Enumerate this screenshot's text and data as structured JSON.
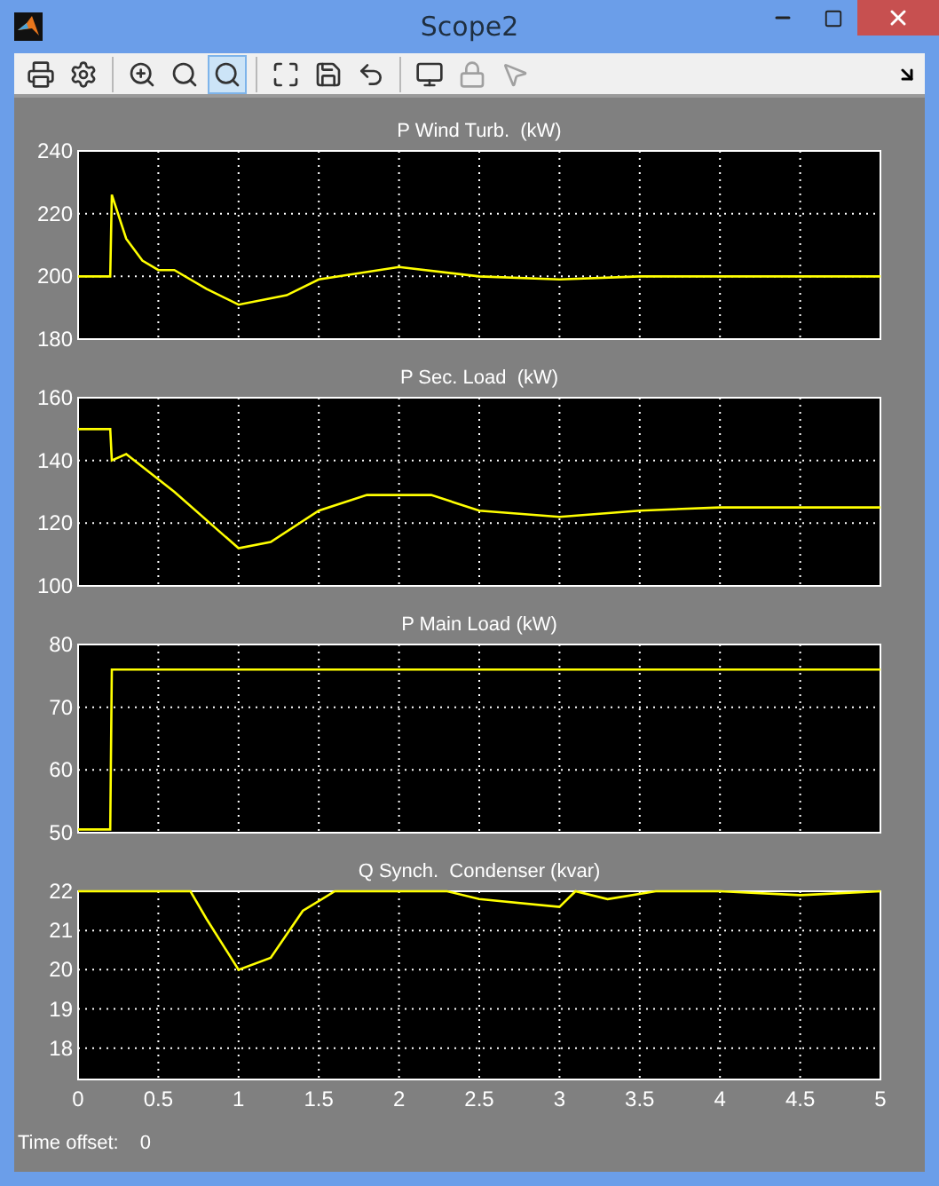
{
  "window": {
    "title": "Scope2"
  },
  "toolbar": {
    "groups": [
      [
        {
          "kind": "print",
          "selected": false,
          "disabled": false
        },
        {
          "kind": "parameters",
          "selected": false,
          "disabled": false
        }
      ],
      [
        {
          "kind": "zoom",
          "selected": false,
          "disabled": false
        },
        {
          "kind": "zoom_x",
          "selected": false,
          "disabled": false
        },
        {
          "kind": "zoom_y",
          "selected": true,
          "disabled": false
        }
      ],
      [
        {
          "kind": "autoscale",
          "selected": false,
          "disabled": false
        },
        {
          "kind": "save_axes",
          "selected": false,
          "disabled": false
        },
        {
          "kind": "restore_axes",
          "selected": false,
          "disabled": false
        }
      ],
      [
        {
          "kind": "floating",
          "selected": false,
          "disabled": false
        },
        {
          "kind": "lock",
          "selected": false,
          "disabled": true
        },
        {
          "kind": "signal_select",
          "selected": false,
          "disabled": true
        }
      ]
    ]
  },
  "scopes": [
    {
      "chart_data": {
        "type": "line",
        "title": "P Wind Turb.  (kW)",
        "x": [
          0,
          0.2,
          0.21,
          0.3,
          0.4,
          0.5,
          0.6,
          0.8,
          1.0,
          1.3,
          1.5,
          2.0,
          2.5,
          3.0,
          3.5,
          4.0,
          4.5,
          5.0
        ],
        "series": [
          {
            "color": "#ffff00",
            "values": [
              200,
              200,
              226,
              212,
              205,
              202,
              202,
              196,
              191,
              194,
              199,
              203,
              200,
              199,
              200,
              200,
              200,
              200
            ]
          }
        ],
        "xlim": [
          0,
          5
        ],
        "ylim": [
          180,
          240
        ],
        "yticks": [
          180,
          200,
          220,
          240
        ],
        "grid": true
      }
    },
    {
      "chart_data": {
        "type": "line",
        "title": "P Sec. Load  (kW)",
        "x": [
          0,
          0.2,
          0.21,
          0.3,
          0.6,
          1.0,
          1.2,
          1.5,
          1.8,
          2.2,
          2.5,
          3.0,
          3.5,
          4.0,
          4.5,
          5.0
        ],
        "series": [
          {
            "color": "#ffff00",
            "values": [
              150,
              150,
              140,
              142,
              130,
              112,
              114,
              124,
              129,
              129,
              124,
              122,
              124,
              125,
              125,
              125
            ]
          }
        ],
        "xlim": [
          0,
          5
        ],
        "ylim": [
          100,
          160
        ],
        "yticks": [
          100,
          120,
          140,
          160
        ],
        "grid": true
      }
    },
    {
      "chart_data": {
        "type": "line",
        "title": "P Main Load (kW)",
        "x": [
          0,
          0.2,
          0.21,
          0.3,
          5.0
        ],
        "series": [
          {
            "color": "#ffff00",
            "values": [
              50.5,
              50.5,
              76,
              76,
              76
            ]
          }
        ],
        "xlim": [
          0,
          5
        ],
        "ylim": [
          50,
          80
        ],
        "yticks": [
          50,
          60,
          70,
          80
        ],
        "grid": true
      }
    },
    {
      "chart_data": {
        "type": "line",
        "title": "Q Synch.  Condenser (kvar)",
        "x": [
          0,
          0.7,
          0.8,
          1.0,
          1.2,
          1.4,
          1.6,
          2.3,
          2.5,
          3.0,
          3.1,
          3.3,
          3.6,
          4.0,
          4.5,
          5.0
        ],
        "series": [
          {
            "color": "#ffff00",
            "values": [
              22,
              22,
              21.3,
              20,
              20.3,
              21.5,
              22,
              22,
              21.8,
              21.6,
              22,
              21.8,
              22,
              22,
              21.9,
              22
            ]
          }
        ],
        "xlim": [
          0,
          5
        ],
        "ylim": [
          17.2,
          22
        ],
        "xticks": [
          0,
          0.5,
          1,
          1.5,
          2,
          2.5,
          3,
          3.5,
          4,
          4.5,
          5
        ],
        "yticks": [
          18,
          19,
          20,
          21,
          22
        ],
        "grid": true
      }
    }
  ],
  "footer": {
    "label": "Time offset:",
    "value": "0"
  }
}
